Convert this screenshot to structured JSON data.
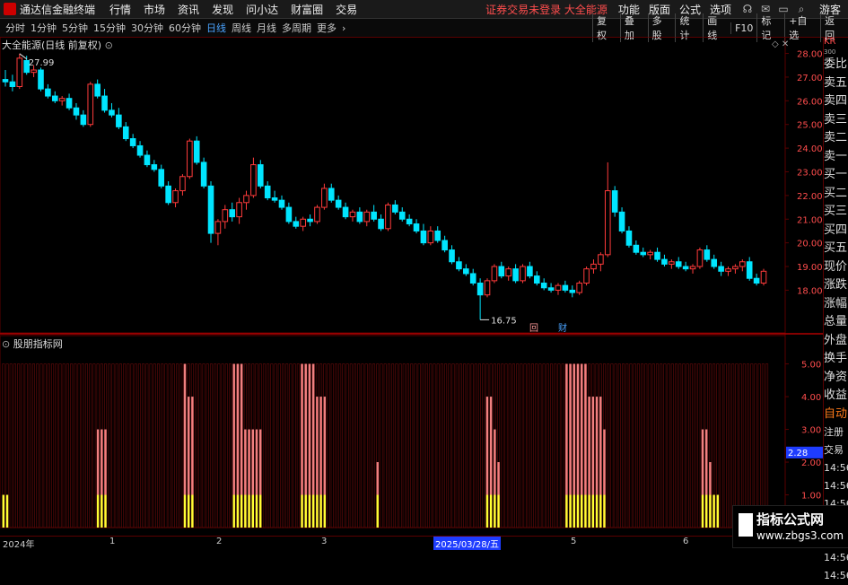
{
  "titlebar": {
    "app_name": "通达信金融终端",
    "menus": [
      "行情",
      "市场",
      "资讯",
      "发现",
      "问小达",
      "财富圈",
      "交易"
    ],
    "warning": "证券交易未登录  大全能源",
    "right_menus": [
      "功能",
      "版面",
      "公式",
      "选项"
    ],
    "guest": "游客"
  },
  "periods": {
    "items": [
      "分时",
      "1分钟",
      "5分钟",
      "15分钟",
      "30分钟",
      "60分钟",
      "日线",
      "周线",
      "月线",
      "多周期",
      "更多"
    ],
    "active": "日线",
    "tools": [
      "复权",
      "叠加",
      "多股",
      "统计",
      "画线",
      "F10",
      "标记",
      "+自选",
      "返回"
    ]
  },
  "main_chart": {
    "title": "大全能源(日线 前复权)",
    "y_ticks": [
      "28.00",
      "27.00",
      "26.00",
      "25.00",
      "24.00",
      "23.00",
      "22.00",
      "21.00",
      "20.00",
      "19.00",
      "18.00"
    ],
    "high_label": "27.99",
    "low_label": "16.75",
    "markers": [
      "回",
      "财"
    ]
  },
  "indicator": {
    "title": "股朋指标网",
    "y_ticks": [
      "5.00",
      "4.00",
      "3.00",
      "2.00",
      "1.00"
    ],
    "current_value": "2.28"
  },
  "side_panel": {
    "header": "KR",
    "code": "300",
    "rows": [
      "委比",
      "卖五",
      "卖四",
      "卖三",
      "卖二",
      "卖一",
      "买一",
      "买二",
      "买三",
      "买四",
      "买五",
      "现价",
      "涨跌",
      "涨幅",
      "总量",
      "外盘",
      "换手",
      "净资",
      "收益"
    ],
    "auto": "自动",
    "lower_rows": [
      "注册",
      "交易",
      "14:56",
      "14:56",
      "14:56",
      "14:56",
      "14:56",
      "14:56",
      "14:56"
    ]
  },
  "x_axis": {
    "labels": [
      "2024年",
      "1",
      "2",
      "3",
      "2025/03/28/五",
      "5",
      "6"
    ]
  },
  "watermark": {
    "line1": "指标公式网",
    "line2": "www.zbgs3.com"
  },
  "colors": {
    "up": "#ff3b3b",
    "down": "#00e5ff",
    "bar_pink": "#f08080",
    "bar_yellow": "#ffff33",
    "grid_red": "#5a0000",
    "price_label": "#ff4d4d"
  },
  "chart_data": [
    {
      "type": "candlestick",
      "title": "大全能源(日线 前复权)",
      "ylim": [
        16.5,
        28.4
      ],
      "ohlc": [
        [
          26.9,
          27.3,
          26.6,
          26.8
        ],
        [
          26.8,
          27.1,
          26.4,
          26.6
        ],
        [
          26.6,
          27.99,
          26.5,
          27.8
        ],
        [
          27.7,
          27.9,
          27.1,
          27.2
        ],
        [
          27.2,
          27.5,
          27.0,
          27.3
        ],
        [
          27.3,
          27.4,
          26.4,
          26.5
        ],
        [
          26.5,
          26.7,
          26.1,
          26.2
        ],
        [
          26.2,
          26.4,
          25.9,
          26.0
        ],
        [
          26.0,
          26.2,
          25.8,
          26.1
        ],
        [
          26.1,
          26.3,
          25.6,
          25.7
        ],
        [
          25.7,
          25.9,
          25.2,
          25.4
        ],
        [
          25.4,
          25.6,
          24.9,
          25.0
        ],
        [
          25.0,
          26.8,
          24.9,
          26.7
        ],
        [
          26.7,
          26.9,
          26.1,
          26.2
        ],
        [
          26.2,
          26.5,
          25.5,
          25.6
        ],
        [
          25.6,
          25.9,
          25.3,
          25.4
        ],
        [
          25.4,
          25.7,
          24.8,
          24.9
        ],
        [
          24.9,
          25.1,
          24.3,
          24.4
        ],
        [
          24.4,
          24.6,
          24.0,
          24.1
        ],
        [
          24.1,
          24.3,
          23.6,
          23.7
        ],
        [
          23.7,
          23.9,
          23.2,
          23.3
        ],
        [
          23.3,
          23.5,
          23.0,
          23.1
        ],
        [
          23.1,
          23.3,
          22.3,
          22.4
        ],
        [
          22.4,
          22.6,
          21.6,
          21.7
        ],
        [
          21.7,
          22.3,
          21.5,
          22.2
        ],
        [
          22.2,
          22.9,
          22.0,
          22.8
        ],
        [
          22.8,
          24.4,
          22.7,
          24.3
        ],
        [
          24.3,
          24.5,
          23.3,
          23.4
        ],
        [
          23.4,
          23.6,
          22.3,
          22.4
        ],
        [
          22.4,
          22.6,
          20.0,
          20.4
        ],
        [
          20.4,
          21.0,
          19.9,
          20.9
        ],
        [
          20.9,
          21.6,
          20.6,
          21.4
        ],
        [
          21.4,
          21.7,
          20.9,
          21.1
        ],
        [
          21.1,
          21.9,
          20.8,
          21.7
        ],
        [
          21.7,
          22.2,
          21.4,
          22.0
        ],
        [
          22.0,
          23.6,
          21.9,
          23.3
        ],
        [
          23.3,
          23.5,
          22.3,
          22.4
        ],
        [
          22.4,
          22.6,
          21.8,
          21.9
        ],
        [
          21.9,
          22.2,
          21.7,
          21.8
        ],
        [
          21.8,
          22.0,
          21.4,
          21.5
        ],
        [
          21.5,
          21.7,
          20.8,
          20.9
        ],
        [
          20.9,
          21.1,
          20.6,
          20.7
        ],
        [
          20.7,
          21.1,
          20.5,
          21.0
        ],
        [
          21.0,
          21.2,
          20.7,
          20.9
        ],
        [
          20.9,
          21.6,
          20.8,
          21.5
        ],
        [
          21.5,
          22.5,
          21.4,
          22.3
        ],
        [
          22.3,
          22.5,
          21.7,
          21.8
        ],
        [
          21.8,
          22.0,
          21.4,
          21.5
        ],
        [
          21.5,
          21.7,
          21.0,
          21.1
        ],
        [
          21.1,
          21.4,
          20.9,
          21.3
        ],
        [
          21.3,
          21.5,
          20.8,
          20.9
        ],
        [
          20.9,
          21.4,
          20.7,
          21.3
        ],
        [
          21.3,
          21.6,
          20.9,
          21.0
        ],
        [
          21.0,
          21.2,
          20.5,
          20.6
        ],
        [
          20.6,
          21.7,
          20.5,
          21.6
        ],
        [
          21.6,
          21.8,
          21.2,
          21.3
        ],
        [
          21.3,
          21.5,
          20.9,
          21.0
        ],
        [
          21.0,
          21.2,
          20.7,
          20.8
        ],
        [
          20.8,
          21.0,
          20.4,
          20.5
        ],
        [
          20.5,
          20.8,
          19.9,
          20.0
        ],
        [
          20.0,
          20.7,
          19.9,
          20.5
        ],
        [
          20.5,
          20.7,
          20.0,
          20.1
        ],
        [
          20.1,
          20.3,
          19.6,
          19.7
        ],
        [
          19.7,
          19.9,
          19.1,
          19.2
        ],
        [
          19.2,
          19.4,
          18.8,
          18.9
        ],
        [
          18.9,
          19.1,
          18.6,
          18.7
        ],
        [
          18.7,
          18.9,
          18.2,
          18.3
        ],
        [
          18.3,
          18.5,
          16.75,
          17.8
        ],
        [
          17.8,
          18.5,
          17.7,
          18.4
        ],
        [
          18.4,
          19.1,
          18.3,
          19.0
        ],
        [
          19.0,
          19.2,
          18.5,
          18.6
        ],
        [
          18.6,
          19.0,
          18.4,
          18.9
        ],
        [
          18.9,
          19.1,
          18.3,
          18.4
        ],
        [
          18.4,
          19.1,
          18.3,
          19.0
        ],
        [
          19.0,
          19.2,
          18.5,
          18.6
        ],
        [
          18.6,
          18.8,
          18.2,
          18.3
        ],
        [
          18.3,
          18.5,
          18.0,
          18.1
        ],
        [
          18.1,
          18.3,
          17.9,
          18.0
        ],
        [
          18.0,
          18.3,
          17.8,
          18.2
        ],
        [
          18.2,
          18.4,
          17.9,
          18.0
        ],
        [
          18.0,
          18.2,
          17.7,
          17.9
        ],
        [
          17.9,
          18.4,
          17.8,
          18.3
        ],
        [
          18.3,
          19.0,
          18.2,
          18.9
        ],
        [
          18.9,
          19.3,
          18.7,
          19.1
        ],
        [
          19.1,
          19.6,
          18.8,
          19.5
        ],
        [
          19.5,
          23.4,
          19.4,
          22.2
        ],
        [
          22.2,
          22.4,
          21.1,
          21.3
        ],
        [
          21.3,
          21.5,
          20.4,
          20.5
        ],
        [
          20.5,
          20.7,
          19.8,
          19.9
        ],
        [
          19.9,
          20.1,
          19.5,
          19.6
        ],
        [
          19.6,
          19.8,
          19.4,
          19.5
        ],
        [
          19.5,
          19.7,
          19.3,
          19.6
        ],
        [
          19.6,
          19.8,
          19.2,
          19.3
        ],
        [
          19.3,
          19.5,
          19.0,
          19.1
        ],
        [
          19.1,
          19.3,
          18.9,
          19.2
        ],
        [
          19.2,
          19.4,
          18.9,
          19.0
        ],
        [
          19.0,
          19.2,
          18.8,
          18.9
        ],
        [
          18.9,
          19.1,
          18.7,
          19.0
        ],
        [
          19.0,
          19.8,
          18.9,
          19.7
        ],
        [
          19.7,
          19.9,
          19.2,
          19.3
        ],
        [
          19.3,
          19.5,
          18.9,
          19.0
        ],
        [
          19.0,
          19.2,
          18.6,
          18.8
        ],
        [
          18.8,
          19.0,
          18.6,
          18.9
        ],
        [
          18.9,
          19.1,
          18.7,
          19.0
        ],
        [
          19.0,
          19.3,
          18.8,
          19.2
        ],
        [
          19.2,
          19.4,
          18.4,
          18.5
        ],
        [
          18.5,
          18.7,
          18.2,
          18.3
        ],
        [
          18.3,
          18.9,
          18.2,
          18.8
        ]
      ]
    },
    {
      "type": "bar",
      "title": "股朋指标网",
      "ylim": [
        0,
        5.4
      ],
      "values": [
        1,
        1,
        0,
        0,
        0,
        0,
        0,
        0,
        0,
        0,
        0,
        0,
        0,
        0,
        0,
        0,
        0,
        0,
        0,
        0,
        0,
        0,
        0,
        0,
        0,
        3,
        3,
        3,
        0,
        0,
        0,
        0,
        0,
        0,
        0,
        0,
        0,
        0,
        0,
        0,
        0,
        0,
        0,
        0,
        0,
        0,
        0,
        0,
        5,
        4,
        4,
        0,
        0,
        0,
        0,
        0,
        0,
        0,
        0,
        0,
        0,
        5,
        5,
        5,
        3,
        3,
        3,
        3,
        3,
        0,
        0,
        0,
        0,
        0,
        0,
        0,
        0,
        0,
        0,
        5,
        5,
        5,
        5,
        4,
        4,
        4,
        0,
        0,
        0,
        0,
        0,
        0,
        0,
        0,
        0,
        0,
        0,
        0,
        0,
        2,
        0,
        0,
        0,
        0,
        0,
        0,
        0,
        0,
        0,
        0,
        0,
        0,
        0,
        0,
        0,
        0,
        0,
        0,
        0,
        0,
        0,
        0,
        0,
        0,
        0,
        0,
        0,
        0,
        4,
        4,
        3,
        2,
        0,
        0,
        0,
        0,
        0,
        0,
        0,
        0,
        0,
        0,
        0,
        0,
        0,
        0,
        0,
        0,
        0,
        5,
        5,
        5,
        5,
        5,
        5,
        4,
        4,
        4,
        4,
        3,
        0,
        0,
        0,
        0,
        0,
        0,
        0,
        0,
        0,
        0,
        0,
        0,
        0,
        0,
        0,
        0,
        0,
        0,
        0,
        0,
        0,
        0,
        0,
        0,
        0,
        3,
        3,
        2,
        1,
        1,
        0,
        0,
        0,
        0,
        0,
        0,
        0,
        0,
        0,
        0,
        0,
        0,
        0
      ],
      "yellow_cap": 1
    }
  ]
}
